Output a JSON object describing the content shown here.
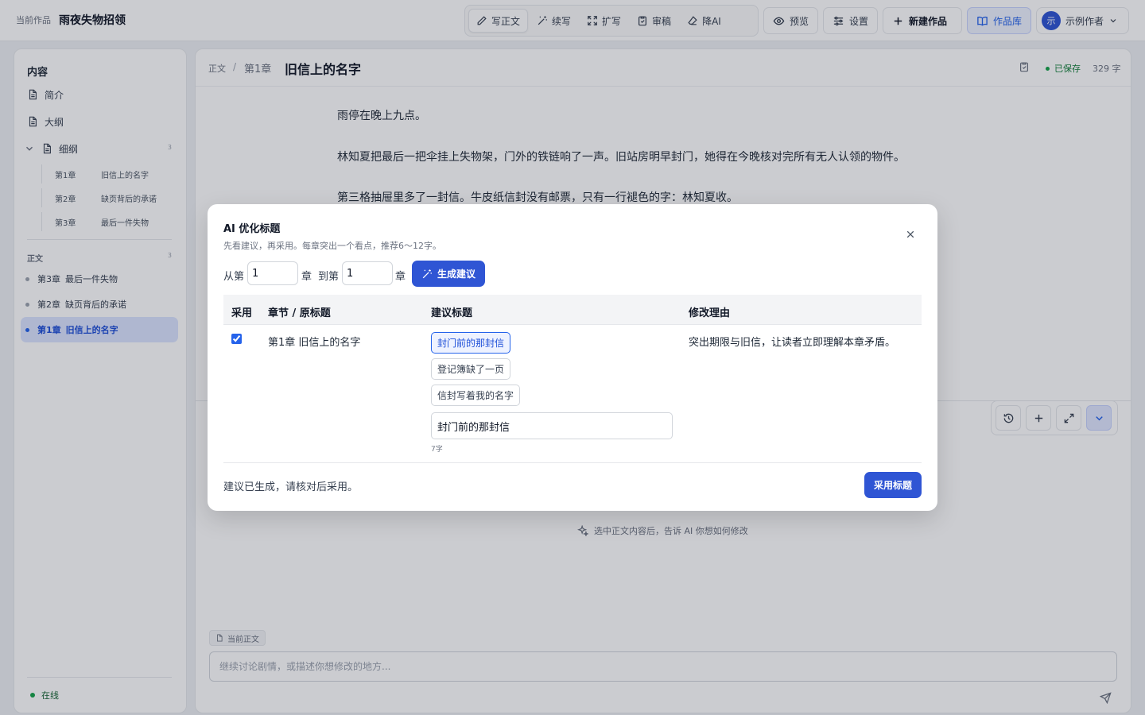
{
  "header": {
    "current_label": "当前作品",
    "work_title": "雨夜失物招领",
    "tools": [
      {
        "label": "写正文",
        "icon": "pen-icon"
      },
      {
        "label": "续写",
        "icon": "magic-wand-icon"
      },
      {
        "label": "扩写",
        "icon": "expand-icon"
      },
      {
        "label": "审稿",
        "icon": "clipboard-check-icon"
      },
      {
        "label": "降AI",
        "icon": "eraser-icon"
      }
    ],
    "preview_label": "预览",
    "settings_label": "设置",
    "new_work_label": "新建作品",
    "library_label": "作品库",
    "user": {
      "avatar_text": "示",
      "name": "示例作者"
    }
  },
  "sidebar": {
    "heading": "内容",
    "items": [
      {
        "label": "简介",
        "icon": "document-icon"
      },
      {
        "label": "大纲",
        "icon": "document-icon"
      },
      {
        "label": "细纲",
        "icon": "document-icon",
        "count": "3"
      }
    ],
    "outline_children": [
      {
        "num": "第1章",
        "title": "旧信上的名字"
      },
      {
        "num": "第2章",
        "title": "缺页背后的承诺"
      },
      {
        "num": "第3章",
        "title": "最后一件失物"
      }
    ],
    "section_label": "正文",
    "section_count": "3",
    "chapters": [
      {
        "num": "第3章",
        "title": "最后一件失物",
        "active": false
      },
      {
        "num": "第2章",
        "title": "缺页背后的承诺",
        "active": false
      },
      {
        "num": "第1章",
        "title": "旧信上的名字",
        "active": true
      }
    ],
    "status": "在线"
  },
  "editor": {
    "breadcrumb": {
      "section": "正文",
      "chapter": "第1章",
      "title": "旧信上的名字"
    },
    "saved_label": "已保存",
    "word_count": "329 字",
    "paragraphs": [
      "雨停在晚上九点。",
      "林知夏把最后一把伞挂上失物架，门外的铁链响了一声。旧站房明早封门，她得在今晚核对完所有无人认领的物件。",
      "第三格抽屉里多了一封信。牛皮纸信封没有邮票，只有一行褪色的字：林知夏收。"
    ],
    "hint": "选中正文内容后，告诉 AI 你想如何修改",
    "context_tag": "当前正文",
    "chat_placeholder": "继续讨论剧情，或描述你想修改的地方..."
  },
  "modal": {
    "title": "AI 优化标题",
    "subtitle": "先看建议，再采用。每章突出一个看点，推荐6～12字。",
    "range": {
      "from_label": "从第",
      "from_value": "1",
      "unit1": "章",
      "to_label": "到第",
      "to_value": "1",
      "unit2": "章"
    },
    "generate_label": "生成建议",
    "columns": {
      "adopt": "采用",
      "chapter": "章节 / 原标题",
      "suggestion": "建议标题",
      "reason": "修改理由"
    },
    "row": {
      "checked": true,
      "chapter": "第1章 旧信上的名字",
      "suggestions": [
        "封门前的那封信",
        "登记簿缺了一页",
        "信封写着我的名字"
      ],
      "selected_index": 0,
      "title_value": "封门前的那封信",
      "char_count": "7字",
      "reason": "突出期限与旧信，让读者立即理解本章矛盾。"
    },
    "status": "建议已生成，请核对后采用。",
    "apply_label": "采用标题"
  }
}
